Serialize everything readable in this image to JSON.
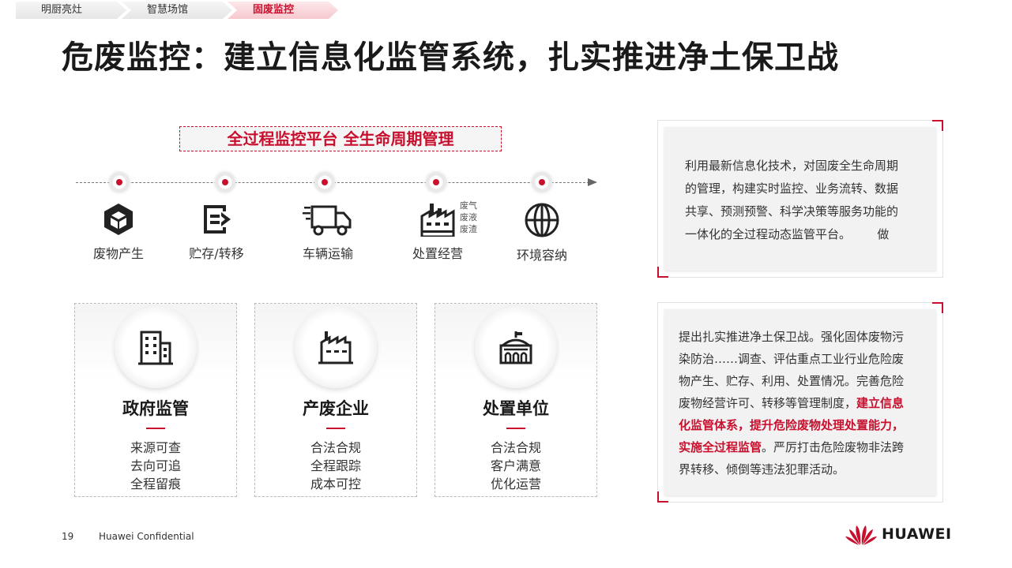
{
  "breadcrumb": {
    "items": [
      {
        "label": "明厨亮灶"
      },
      {
        "label": "智慧场馆"
      },
      {
        "label": "固废监控"
      }
    ]
  },
  "title": "危废监控：建立信息化监管系统，扎实推进净土保卫战",
  "banner": "全过程监控平台  全生命周期管理",
  "lifecycle": {
    "stages": [
      {
        "label": "废物产生",
        "icon": "box-icon"
      },
      {
        "label": "贮存/转移",
        "icon": "export-icon"
      },
      {
        "label": "车辆运输",
        "icon": "truck-icon"
      },
      {
        "label": "处置经营",
        "icon": "factory-icon"
      },
      {
        "label": "环境容纳",
        "icon": "globe-icon"
      }
    ],
    "emissions": [
      "废气",
      "废液",
      "废渣"
    ]
  },
  "cards": [
    {
      "title": "政府监管",
      "icon": "government-building-icon",
      "lines": [
        "来源可查",
        "去向可追",
        "全程留痕"
      ]
    },
    {
      "title": "产废企业",
      "icon": "factory-icon",
      "lines": [
        "合法合规",
        "全程跟踪",
        "成本可控"
      ]
    },
    {
      "title": "处置单位",
      "icon": "disposal-facility-icon",
      "lines": [
        "合法合规",
        "客户满意",
        "优化运营"
      ]
    }
  ],
  "panel1": {
    "lines": [
      "利用最新信息化技术，对固废全生命周期",
      "的管理，构建实时监控、业务流转、数据",
      "共享、预测预警、科学决策等服务功能的",
      "一体化的全过程动态监管平台。       做"
    ]
  },
  "panel2": {
    "l1": "提出扎实推进净土保卫战。强化固体废物污",
    "l2": "染防治……调查、评估重点工业行业危险废",
    "l3": "物产生、贮存、利用、处置情况。完善危险",
    "l4_normal": "废物经营许可、转移等管理制度，",
    "l4_red": "建立信息",
    "l5_red": "化监管体系，提升危险废物处理处置能力，",
    "l6_red": "实施全过程监管",
    "l6_normal": "。严厉打击危险废物非法跨",
    "l7": "界转移、倾倒等违法犯罪活动。"
  },
  "footer": {
    "page": "19",
    "confidential": "Huawei Confidential",
    "logo": "HUAWEI"
  },
  "colors": {
    "accent": "#c8102e",
    "text": "#333333",
    "panel": "#f2f2f2"
  }
}
